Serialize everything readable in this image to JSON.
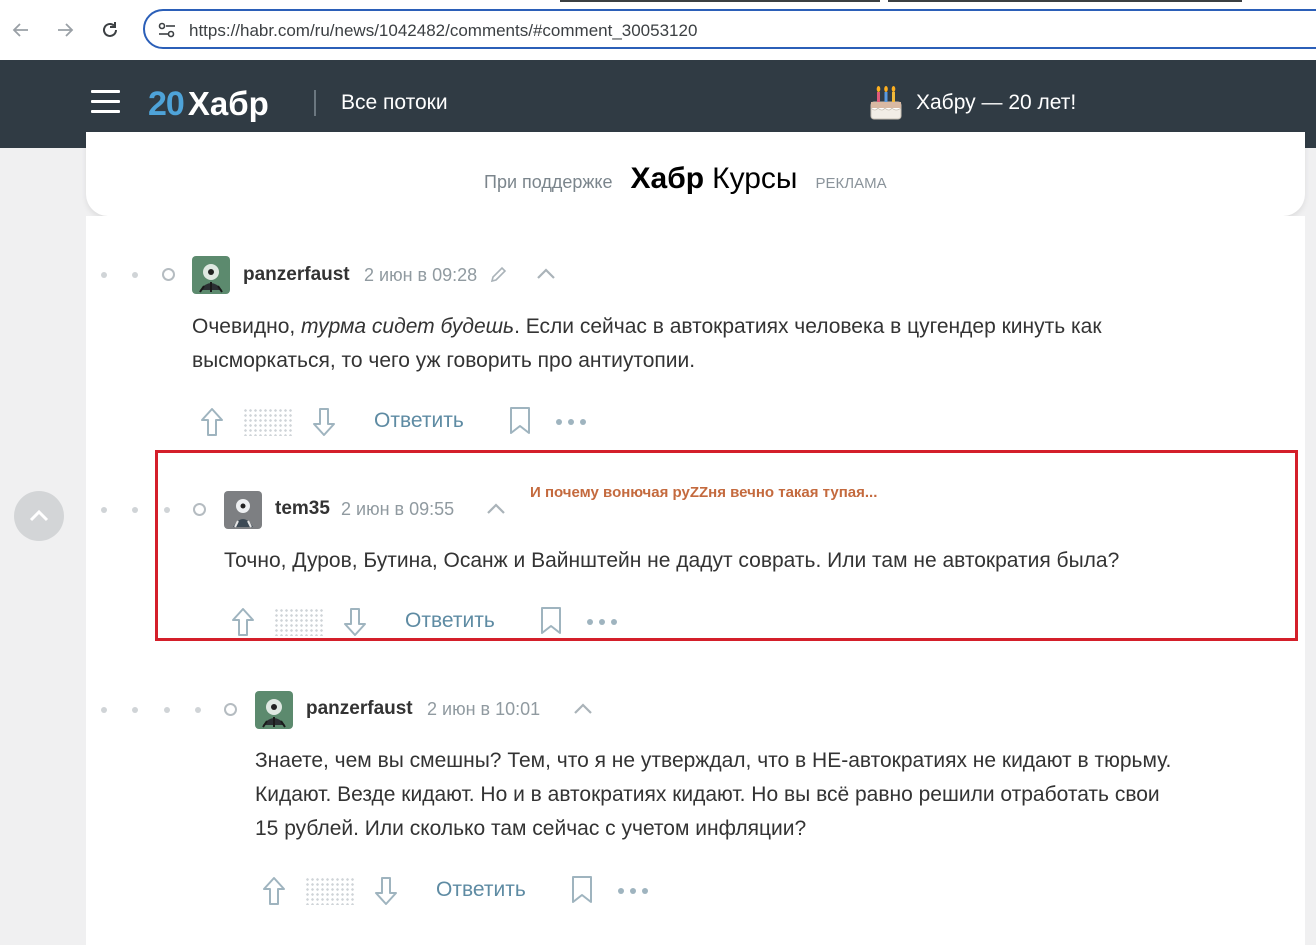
{
  "browser": {
    "url": "https://habr.com/ru/news/1042482/comments/#comment_30053120",
    "icons": {
      "back": "back-arrow-icon",
      "forward": "forward-arrow-icon",
      "reload": "reload-icon",
      "site_info": "tune-icon"
    }
  },
  "header": {
    "logo_number": "20",
    "logo_text": "Хабр",
    "all_streams": "Все потоки",
    "anniversary": "Хабру — 20 лет!",
    "bg_color": "#303b44",
    "logo_accent": "#4ea3d9"
  },
  "sponsor": {
    "supported_by": "При поддержке",
    "brand_bold": "Хабр",
    "brand_light": "Курсы",
    "ad_label": "РЕКЛАМА"
  },
  "comments": [
    {
      "author": "panzerfaust",
      "date": "2 июн в 09:28",
      "text_before_italic": "Очевидно, ",
      "text_italic": "турма сидет будешь",
      "text_after_italic": ". Если сейчас в автократиях человека в цугендер кинуть как",
      "text_line2": "высморкаться, то чего уж говорить про антиутопии.",
      "reply_label": "Ответить"
    },
    {
      "author": "tem35",
      "date": "2 июн в 09:55",
      "text": "Точно, Дуров, Бутина, Осанж и Вайнштейн не дадут соврать. Или там не автократия была?",
      "reply_label": "Ответить",
      "highlighted": true
    },
    {
      "author": "panzerfaust",
      "date": "2 июн в 10:01",
      "text_line1": "Знаете, чем вы смешны? Тем, что я не утверждал, что в НЕ-автократиях не кидают в тюрьму.",
      "text_line2": "Кидают. Везде кидают. Но и в автократиях кидают. Но вы всё равно решили отработать свои",
      "text_line3": "15 рублей. Или сколько там сейчас с учетом инфляции?",
      "reply_label": "Ответить"
    }
  ],
  "annotation": {
    "text": "И почему вонючая руZZня вечно такая тупая...",
    "color": "#c46a3e",
    "frame_color": "#d41f2a"
  }
}
